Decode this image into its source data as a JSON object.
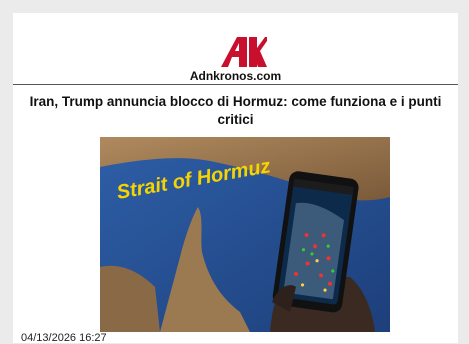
{
  "site": {
    "name": "Adnkronos.com",
    "logo_text": "AK",
    "brand_color": "#c8102e"
  },
  "article": {
    "title": "Iran, Trump annuncia blocco di Hormuz: come funziona e i punti critici",
    "image_caption_text": "Strait of Hormuz",
    "date": "04/13/2026 16:27"
  },
  "icons": [
    "adnkronos-logo-icon"
  ]
}
